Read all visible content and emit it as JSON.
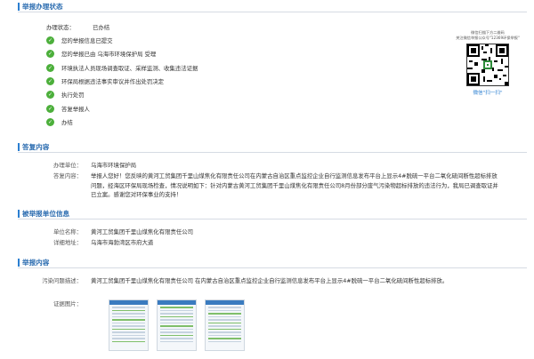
{
  "sections": {
    "status": "举报办理状态",
    "reply": "答复内容",
    "unit": "被举报单位信息",
    "content": "举报内容"
  },
  "status": {
    "label": "办理状态：",
    "value": "已办结",
    "steps": [
      "您的举报信息已提交",
      "您的举报已由 乌海市环境保护局 受理",
      "环境执法人员现场调查取证、采样监测、收集违法证据",
      "环保局根据违法事实审议并作出处罚决定",
      "执行处罚",
      "答复举报人",
      "办结"
    ]
  },
  "qr": {
    "caption1": "微信扫描下方二维码",
    "caption2": "关注微信举报公众号\"12369环保举报\"",
    "bottom": "微信\"扫一扫\""
  },
  "reply": {
    "unit_label": "办理单位：",
    "unit_value": "乌海市环境保护局",
    "content_label": "答复内容：",
    "content_value": "举报人您好！您反映的黄河工贸集团千里山煤焦化有限责任公司在内蒙古自治区重点监控企业自行监测信息发布平台上显示4#脱硫一平台二氧化硫间断性超标排放问题，经海区环保局现场检查，情况说明如下：针对内蒙古黄河工贸集团千里山煤焦化有限责任公司8月份部分废气污染物超标排放的违法行为，我局已调查取证并已立案。感谢您对环保事业的支持！"
  },
  "unit": {
    "name_label": "单位名称：",
    "name_value": "黄河工贸集团千里山煤焦化有限责任公司",
    "addr_label": "详细地址：",
    "addr_value": "乌海市海勃湾区市府大道"
  },
  "content": {
    "desc_label": "污染问题描述：",
    "desc_value": "黄河工贸集团千里山煤焦化有限责任公司 在内蒙古自治区重点监控企业自行监测信息发布平台上显示4#脱硫一平台二氧化硫间断性超标排放。",
    "images_label": "证据图片："
  }
}
